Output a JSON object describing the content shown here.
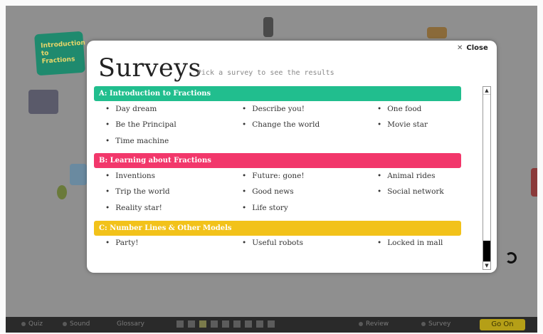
{
  "colors": {
    "section_a": "#21be8e",
    "section_b": "#f2376b",
    "section_c": "#f2c21a",
    "go_on": "#b59f17"
  },
  "background": {
    "tag_text": "Introduction to Fractions"
  },
  "bottom_bar": {
    "items": [
      "Quiz",
      "Sound",
      "Glossary",
      "Review",
      "Survey"
    ],
    "go_on_label": "Go On"
  },
  "modal": {
    "close_label": "Close",
    "close_icon": "close-icon",
    "title": "Surveys",
    "subtitle": "Pick a survey to see the results",
    "sections": [
      {
        "heading": "A: Introduction to Fractions",
        "items": [
          "Day dream",
          "Describe you!",
          "One food",
          "Be the Principal",
          "Change the world",
          "Movie star",
          "Time machine"
        ]
      },
      {
        "heading": "B: Learning about Fractions",
        "items": [
          "Inventions",
          "Future: gone!",
          "Animal rides",
          "Trip the world",
          "Good news",
          "Social network",
          "Reality star!",
          "Life story"
        ]
      },
      {
        "heading": "C: Number Lines & Other Models",
        "items": [
          "Party!",
          "Useful robots",
          "Locked in mall"
        ]
      }
    ]
  }
}
